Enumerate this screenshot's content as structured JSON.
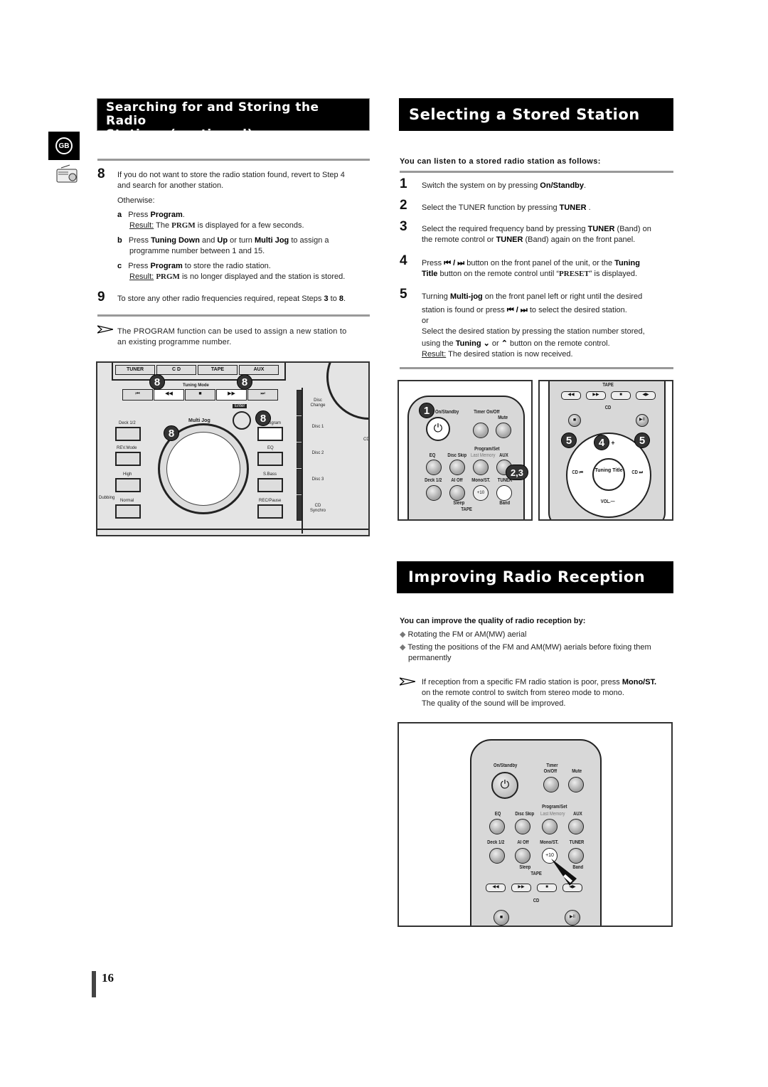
{
  "left_section": {
    "title_line1": "Searching for and Storing the Radio",
    "title_line2": "Stations (continued)",
    "lang_badge": "GB",
    "step8": {
      "num": "8",
      "line1": "If you do not want to store the radio station found, revert to Step 4",
      "line2": "and search for another station.",
      "otherwise": "Otherwise:",
      "a": {
        "letter": "a",
        "pre": "Press ",
        "bold": "Program",
        "post": ".",
        "result_label": "Result:",
        "result_pre": " The ",
        "result_code": "PRGM",
        "result_post": " is displayed for a few seconds."
      },
      "b": {
        "letter": "b",
        "pre": "Press ",
        "bold1": "Tuning  Down",
        "mid1": " and ",
        "bold2": "Up",
        "mid2": " or turn ",
        "bold3": "Multi Jog",
        "post": " to assign a",
        "line2": "programme number between 1 and 15."
      },
      "c": {
        "letter": "c",
        "pre": "Press ",
        "bold": "Program",
        "post": " to store the radio station.",
        "result_label": "Result:",
        "result_code": "PRGM",
        "result_post": " is no longer displayed and the station is stored."
      }
    },
    "step9": {
      "num": "9",
      "pre": "To store any other radio frequencies required, repeat Steps ",
      "b1": "3",
      "mid": " to ",
      "b2": "8",
      "post": "."
    },
    "note": {
      "line1": "The PROGRAM function can be used to assign a new station to",
      "line2": "an existing programme number."
    },
    "front_panel": {
      "source_buttons": [
        "TUNER",
        "C D",
        "TAPE",
        "AUX"
      ],
      "tuning_mode_label": "Tuning Mode",
      "transport": [
        "⏮",
        "◀◀",
        "■",
        "▶▶",
        "⏭"
      ],
      "enter_label": "Enter",
      "multi_jog_label": "Multi Jog",
      "program_label": "Program",
      "left_buttons": [
        "Deck 1/2",
        "REV.Mode",
        "High",
        "Normal"
      ],
      "dubbing_label": "Dubbing",
      "right_buttons": [
        "EQ",
        "S.Bass",
        "REC/Pause"
      ],
      "disc_labels": [
        "Disc Change",
        "Disc 1",
        "Disc 2",
        "Disc 3",
        "CD Synchro"
      ],
      "cd_label": "CD",
      "step_badges": [
        "8",
        "8",
        "8",
        "8"
      ]
    }
  },
  "selecting": {
    "title": "Selecting a Stored Station",
    "intro": "You can listen to a stored radio station as follows:",
    "steps": [
      {
        "num": "1",
        "pre": "Switch the system on by pressing ",
        "bold": "On/Standby",
        "post": "."
      },
      {
        "num": "2",
        "pre": "Select the TUNER function by pressing ",
        "bold": "TUNER",
        "post": " ."
      },
      {
        "num": "3",
        "pre": "Select the required frequency band by pressing ",
        "bold": "TUNER",
        "post": " (Band) on",
        "line2_pre": "the remote control or ",
        "line2_bold": "TUNER",
        "line2_post": " (Band) again on the front panel."
      },
      {
        "num": "4",
        "pre": "Press ",
        "icons": "⏮ / ⏭",
        "post": "  button on the front panel of the unit, or the ",
        "bold": "Tuning",
        "line2_bold": "Title",
        "line2_pre": " button on the remote control until “",
        "line2_code": "PRESET",
        "line2_post": "” is displayed."
      },
      {
        "num": "5",
        "pre": "Turning ",
        "bold": "Multi-jog",
        "post": " on the front panel  left or right until the desired",
        "line2_pre": "station is found or press ",
        "line2_icons": "⏮ / ⏭",
        "line2_post": " to select the desired station.",
        "or": "or",
        "line3": "Select the desired station by pressing the station number stored,",
        "line4_pre": "using the ",
        "line4_bold": "Tuning",
        "line4_icon1": "⌄",
        "line4_mid": " or ",
        "line4_icon2": "⌃",
        "line4_post": " button on the remote control.",
        "result_label": "Result:",
        "result_text": " The desired station is now received."
      }
    ],
    "remote_left": {
      "labels": [
        "On/Standby",
        "Timer On/Off",
        "Mute",
        "Program/Set",
        "EQ",
        "Disc Skip",
        "Last Memory",
        "AUX",
        "Deck 1/2",
        "AI Off",
        "Mono/ST.",
        "TUNER",
        "+10",
        "Sleep",
        "Band",
        "TAPE"
      ],
      "badges": [
        "1",
        "2,3"
      ]
    },
    "remote_right": {
      "tape_label": "TAPE",
      "cd_label": "CD",
      "tape_buttons": [
        "◀◀",
        "▶▶",
        "■",
        "◀▶"
      ],
      "cd_buttons": [
        "■",
        "▶II"
      ],
      "tuning_label": "Tuning Title",
      "vol_label": "VOL.—",
      "plus": "+",
      "cd_prev": "CD ⏮",
      "cd_next": "CD ⏭",
      "badges": [
        "5",
        "4",
        "5"
      ]
    }
  },
  "improving": {
    "title": "Improving Radio Reception",
    "intro": "You can improve the quality of radio reception by:",
    "bullets": [
      "Rotating the FM or AM(MW) aerial",
      "Testing the positions of the FM and AM(MW) aerials before fixing them",
      "permanently"
    ],
    "note_pre": "If reception from a specific FM radio station is poor, press ",
    "note_bold": "Mono/ST.",
    "note_line2": "on the remote control to switch from stereo mode to mono.",
    "note_line3": "The quality of the sound will be improved.",
    "remote": {
      "labels": [
        "On/Standby",
        "Timer",
        "On/Off",
        "Mute",
        "Program/Set",
        "EQ",
        "Disc Skip",
        "Last Memory",
        "AUX",
        "Deck 1/2",
        "AI Off",
        "Mono/ST.",
        "TUNER",
        "+10",
        "Sleep",
        "Band",
        "TAPE",
        "CD"
      ],
      "tape_buttons": [
        "◀◀",
        "▶▶",
        "■",
        "◀▶"
      ],
      "cd_buttons": [
        "■",
        "▶II"
      ]
    }
  },
  "page_number": "16"
}
